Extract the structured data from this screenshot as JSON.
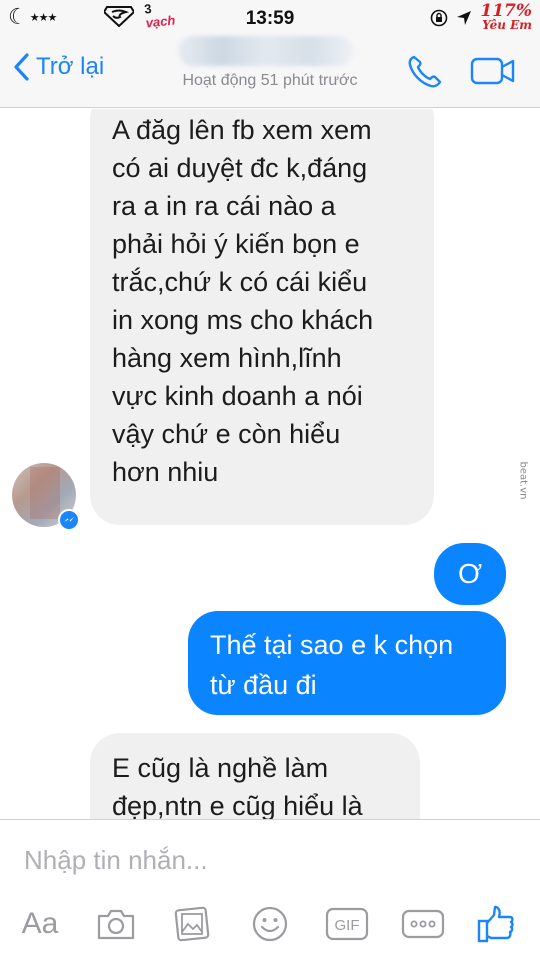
{
  "status_bar": {
    "time": "13:59",
    "carrier": "★★★",
    "sticker_top": "3",
    "sticker_bottom": "vạch",
    "battery": "117%",
    "battery_label": "Yêu Em"
  },
  "header": {
    "back_label": "Trở lại",
    "contact_status": "Hoạt động 51 phút trước"
  },
  "messages": [
    {
      "direction": "incoming",
      "lines": [
        "A đăg lên fb xem xem",
        "có ai duyệt đc k,đáng",
        "ra a in ra cái nào a",
        "phải hỏi ý kiến bọn e",
        "trắc,chứ k có cái kiểu",
        "in xong ms cho khách",
        "hàng xem hình,lĩnh",
        "vực kinh doanh a nói",
        "vậy chứ e còn hiểu",
        "hơn nhiu"
      ]
    },
    {
      "direction": "outgoing",
      "lines": [
        "Ơ"
      ]
    },
    {
      "direction": "outgoing",
      "lines": [
        "Thế tại sao e k chọn",
        "từ đầu đi"
      ]
    },
    {
      "direction": "incoming",
      "lines": [
        "E cũg là nghề làm",
        "đẹp,ntn e cũg hiểu là"
      ]
    }
  ],
  "watermark": "beat.vn",
  "composer": {
    "placeholder": "Nhập tin nhắn...",
    "aa_label": "Aa",
    "gif_label": "GIF"
  },
  "colors": {
    "accent": "#1b86f7",
    "outgoing_bubble": "#0a84ff",
    "incoming_bubble": "#f1f0f0"
  }
}
